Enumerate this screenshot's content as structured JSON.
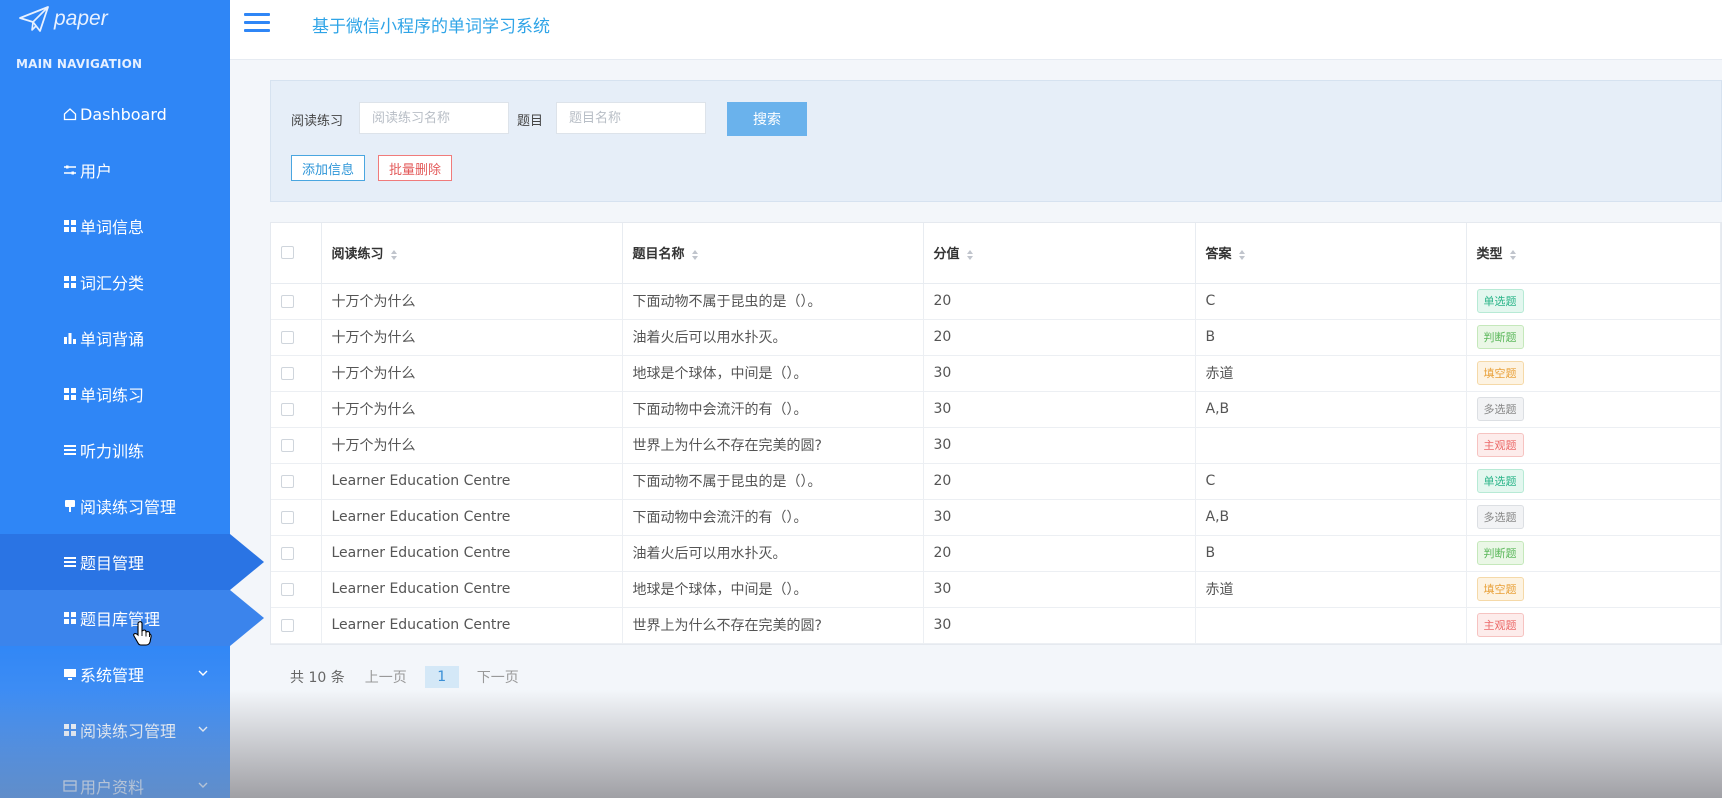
{
  "logo": {
    "text": "paper",
    "icon": "paper-plane-icon"
  },
  "nav_header": "MAIN NAVIGATION",
  "nav": [
    {
      "label": "Dashboard",
      "icon": "home-icon"
    },
    {
      "label": "用户",
      "icon": "sliders-icon"
    },
    {
      "label": "单词信息",
      "icon": "grid-icon"
    },
    {
      "label": "词汇分类",
      "icon": "grid-icon"
    },
    {
      "label": "单词背诵",
      "icon": "bar-chart-icon"
    },
    {
      "label": "单词练习",
      "icon": "grid-icon"
    },
    {
      "label": "听力训练",
      "icon": "list-icon"
    },
    {
      "label": "阅读练习管理",
      "icon": "flag-icon"
    },
    {
      "label": "题目管理",
      "icon": "list-icon",
      "state": "active"
    },
    {
      "label": "题目库管理",
      "icon": "grid-icon",
      "state": "hover"
    },
    {
      "label": "系统管理",
      "icon": "monitor-icon",
      "expandable": true
    },
    {
      "label": "阅读练习管理",
      "icon": "grid-icon",
      "expandable": true
    },
    {
      "label": "用户资料",
      "icon": "card-icon",
      "expandable": true
    }
  ],
  "topbar": {
    "title": "基于微信小程序的单词学习系统"
  },
  "search": {
    "reading_label": "阅读练习",
    "reading_placeholder": "阅读练习名称",
    "question_label": "题目",
    "question_placeholder": "题目名称",
    "search_button": "搜索",
    "add_button": "添加信息",
    "delete_button": "批量删除"
  },
  "table": {
    "columns": [
      "阅读练习",
      "题目名称",
      "分值",
      "答案",
      "类型"
    ],
    "rows": [
      [
        "十万个为什么",
        "下面动物不属于昆虫的是（）。",
        "20",
        "C",
        "单选题"
      ],
      [
        "十万个为什么",
        "油着火后可以用水扑灭。",
        "20",
        "B",
        "判断题"
      ],
      [
        "十万个为什么",
        "地球是个球体，中间是（）。",
        "30",
        "赤道",
        "填空题"
      ],
      [
        "十万个为什么",
        "下面动物中会流汗的有（）。",
        "30",
        "A,B",
        "多选题"
      ],
      [
        "十万个为什么",
        "世界上为什么不存在完美的圆?",
        "30",
        "",
        "主观题"
      ],
      [
        "Learner Education Centre",
        "下面动物不属于昆虫的是（）。",
        "20",
        "C",
        "单选题"
      ],
      [
        "Learner Education Centre",
        "下面动物中会流汗的有（）。",
        "30",
        "A,B",
        "多选题"
      ],
      [
        "Learner Education Centre",
        "油着火后可以用水扑灭。",
        "20",
        "B",
        "判断题"
      ],
      [
        "Learner Education Centre",
        "地球是个球体，中间是（）。",
        "30",
        "赤道",
        "填空题"
      ],
      [
        "Learner Education Centre",
        "世界上为什么不存在完美的圆?",
        "30",
        "",
        "主观题"
      ]
    ]
  },
  "type_colors": {
    "单选题": {
      "color": "#2bb58a",
      "bg": "#e3f7ef",
      "border": "#b7ead5"
    },
    "判断题": {
      "color": "#5cb85c",
      "bg": "#eaf7e6",
      "border": "#c5e8bb"
    },
    "填空题": {
      "color": "#e9a23b",
      "bg": "#fdf3e2",
      "border": "#f5d9a8"
    },
    "多选题": {
      "color": "#888888",
      "bg": "#f2f3f5",
      "border": "#dcdfe3"
    },
    "主观题": {
      "color": "#ec6a6a",
      "bg": "#fdeceb",
      "border": "#f6c3c1"
    }
  },
  "pagination": {
    "total": "共 10 条",
    "prev": "上一页",
    "current": "1",
    "next": "下一页"
  }
}
